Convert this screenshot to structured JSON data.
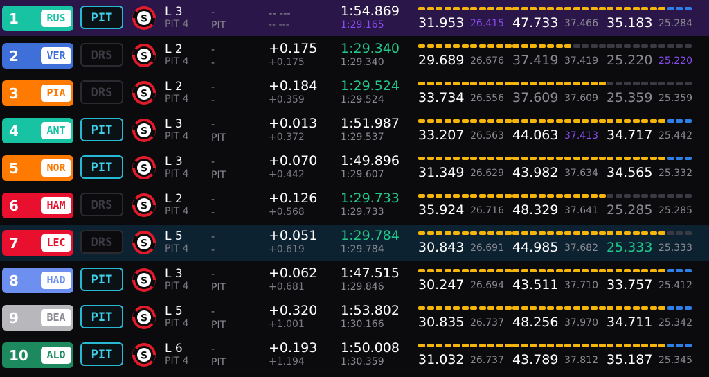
{
  "colors": {
    "yellow": "#f5b50a",
    "blue": "#2f7fe8",
    "dark": "#3a3a44",
    "green": "#22c88a",
    "purple": "#8a4cf0"
  },
  "tyre_icon_letter": "S",
  "rows": [
    {
      "pos": "1",
      "code": "RUS",
      "team_color": "#17c3a3",
      "code_color": "#17c3a3",
      "status": "PIT",
      "status_type": "pit",
      "lap": "L 3",
      "pit_count": "PIT 4",
      "dash1": "-",
      "dash2": "PIT",
      "gap": "-- ---",
      "gap_dim": true,
      "gap2": "-- ---",
      "last_lap": "1:54.869",
      "last_color": "white",
      "best_lap": "1:29.165",
      "best_color": "purple",
      "sectors": [
        {
          "val": "31.953",
          "val_color": "white",
          "best": "26.415",
          "best_color": "purple",
          "segs": "yyyyyyyyyyy"
        },
        {
          "val": "47.733",
          "val_color": "white",
          "best": "37.466",
          "best_color": "grey",
          "segs": "yyyyyyyyyyy"
        },
        {
          "val": "35.183",
          "val_color": "white",
          "best": "25.284",
          "best_color": "grey",
          "segs": "yyyyyyybbb"
        }
      ],
      "highlight": "purple"
    },
    {
      "pos": "2",
      "code": "VER",
      "team_color": "#3f6fd9",
      "code_color": "#3f6fd9",
      "status": "DRS",
      "status_type": "drs",
      "lap": "L 2",
      "pit_count": "PIT 4",
      "dash1": "-",
      "dash2": "-",
      "gap": "+0.175",
      "gap_dim": false,
      "gap2": "+0.175",
      "last_lap": "1:29.340",
      "last_color": "green",
      "best_lap": "1:29.340",
      "best_color": "grey",
      "sectors": [
        {
          "val": "29.689",
          "val_color": "white",
          "best": "26.676",
          "best_color": "grey",
          "segs": "yyyyyyyyyyy"
        },
        {
          "val": "37.419",
          "val_color": "grey",
          "best": "37.419",
          "best_color": "grey",
          "segs": "yyyyyyyddddd"
        },
        {
          "val": "25.220",
          "val_color": "grey",
          "best": "25.220",
          "best_color": "purple",
          "segs": "dddddddddd"
        }
      ],
      "highlight": ""
    },
    {
      "pos": "3",
      "code": "PIA",
      "team_color": "#ff7a00",
      "code_color": "#ff7a00",
      "status": "DRS",
      "status_type": "drs",
      "lap": "L 2",
      "pit_count": "PIT 4",
      "dash1": "-",
      "dash2": "-",
      "gap": "+0.184",
      "gap_dim": false,
      "gap2": "+0.359",
      "last_lap": "1:29.524",
      "last_color": "green",
      "best_lap": "1:29.524",
      "best_color": "grey",
      "sectors": [
        {
          "val": "33.734",
          "val_color": "white",
          "best": "26.556",
          "best_color": "grey",
          "segs": "yyyyyyyyyyy"
        },
        {
          "val": "37.609",
          "val_color": "grey",
          "best": "37.609",
          "best_color": "grey",
          "segs": "yyyyyyyyyyy"
        },
        {
          "val": "25.359",
          "val_color": "grey",
          "best": "25.359",
          "best_color": "grey",
          "segs": "dddddddddd"
        }
      ],
      "highlight": ""
    },
    {
      "pos": "4",
      "code": "ANT",
      "team_color": "#17c3a3",
      "code_color": "#17c3a3",
      "status": "PIT",
      "status_type": "pit",
      "lap": "L 3",
      "pit_count": "PIT 4",
      "dash1": "-",
      "dash2": "PIT",
      "gap": "+0.013",
      "gap_dim": false,
      "gap2": "+0.372",
      "last_lap": "1:51.987",
      "last_color": "white",
      "best_lap": "1:29.537",
      "best_color": "grey",
      "sectors": [
        {
          "val": "33.207",
          "val_color": "white",
          "best": "26.563",
          "best_color": "grey",
          "segs": "yyyyyyyyyyy"
        },
        {
          "val": "44.063",
          "val_color": "white",
          "best": "37.413",
          "best_color": "purple",
          "segs": "yyyyyyyyyyy"
        },
        {
          "val": "34.717",
          "val_color": "white",
          "best": "25.442",
          "best_color": "grey",
          "segs": "yyyyyyybbb"
        }
      ],
      "highlight": ""
    },
    {
      "pos": "5",
      "code": "NOR",
      "team_color": "#ff7a00",
      "code_color": "#ff7a00",
      "status": "PIT",
      "status_type": "pit",
      "lap": "L 3",
      "pit_count": "PIT 4",
      "dash1": "-",
      "dash2": "PIT",
      "gap": "+0.070",
      "gap_dim": false,
      "gap2": "+0.442",
      "last_lap": "1:49.896",
      "last_color": "white",
      "best_lap": "1:29.607",
      "best_color": "grey",
      "sectors": [
        {
          "val": "31.349",
          "val_color": "white",
          "best": "26.629",
          "best_color": "grey",
          "segs": "yyyyyyyyyyy"
        },
        {
          "val": "43.982",
          "val_color": "white",
          "best": "37.634",
          "best_color": "grey",
          "segs": "yyyyyyyyyyy"
        },
        {
          "val": "34.565",
          "val_color": "white",
          "best": "25.332",
          "best_color": "grey",
          "segs": "yyyyyyybbb"
        }
      ],
      "highlight": ""
    },
    {
      "pos": "6",
      "code": "HAM",
      "team_color": "#e8102e",
      "code_color": "#e8102e",
      "status": "DRS",
      "status_type": "drs",
      "lap": "L 2",
      "pit_count": "PIT 4",
      "dash1": "-",
      "dash2": "-",
      "gap": "+0.126",
      "gap_dim": false,
      "gap2": "+0.568",
      "last_lap": "1:29.733",
      "last_color": "green",
      "best_lap": "1:29.733",
      "best_color": "grey",
      "sectors": [
        {
          "val": "35.924",
          "val_color": "white",
          "best": "26.716",
          "best_color": "grey",
          "segs": "yyyyyyyyyyy"
        },
        {
          "val": "48.329",
          "val_color": "white",
          "best": "37.641",
          "best_color": "grey",
          "segs": "yyyyyyyyyyy"
        },
        {
          "val": "25.285",
          "val_color": "grey",
          "best": "25.285",
          "best_color": "grey",
          "segs": "dddddddddd"
        }
      ],
      "highlight": ""
    },
    {
      "pos": "7",
      "code": "LEC",
      "team_color": "#e8102e",
      "code_color": "#e8102e",
      "status": "DRS",
      "status_type": "drs",
      "lap": "L 5",
      "pit_count": "PIT 4",
      "dash1": "-",
      "dash2": "-",
      "gap": "+0.051",
      "gap_dim": false,
      "gap2": "+0.619",
      "last_lap": "1:29.784",
      "last_color": "green",
      "best_lap": "1:29.784",
      "best_color": "grey",
      "sectors": [
        {
          "val": "30.843",
          "val_color": "white",
          "best": "26.691",
          "best_color": "grey",
          "segs": "yyyyyyyyyyy"
        },
        {
          "val": "44.985",
          "val_color": "white",
          "best": "37.682",
          "best_color": "grey",
          "segs": "yyyyyyyyyyy"
        },
        {
          "val": "25.333",
          "val_color": "green",
          "best": "25.333",
          "best_color": "grey",
          "segs": "yyyyyyyddd"
        }
      ],
      "highlight": "teal"
    },
    {
      "pos": "8",
      "code": "HAD",
      "team_color": "#6d8ff0",
      "code_color": "#6d8ff0",
      "status": "PIT",
      "status_type": "pit",
      "lap": "L 3",
      "pit_count": "PIT 4",
      "dash1": "-",
      "dash2": "PIT",
      "gap": "+0.062",
      "gap_dim": false,
      "gap2": "+0.681",
      "last_lap": "1:47.515",
      "last_color": "white",
      "best_lap": "1:29.846",
      "best_color": "grey",
      "sectors": [
        {
          "val": "30.247",
          "val_color": "white",
          "best": "26.694",
          "best_color": "grey",
          "segs": "yyyyyyyyyyy"
        },
        {
          "val": "43.511",
          "val_color": "white",
          "best": "37.710",
          "best_color": "grey",
          "segs": "yyyyyyyyyyy"
        },
        {
          "val": "33.757",
          "val_color": "white",
          "best": "25.412",
          "best_color": "grey",
          "segs": "yyyyyyybbb"
        }
      ],
      "highlight": ""
    },
    {
      "pos": "9",
      "code": "BEA",
      "team_color": "#b8b8bc",
      "code_color": "#8a8a90",
      "status": "PIT",
      "status_type": "pit",
      "lap": "L 5",
      "pit_count": "PIT 4",
      "dash1": "-",
      "dash2": "PIT",
      "gap": "+0.320",
      "gap_dim": false,
      "gap2": "+1.001",
      "last_lap": "1:53.802",
      "last_color": "white",
      "best_lap": "1:30.166",
      "best_color": "grey",
      "sectors": [
        {
          "val": "30.835",
          "val_color": "white",
          "best": "26.737",
          "best_color": "grey",
          "segs": "yyyyyyyyyyy"
        },
        {
          "val": "48.256",
          "val_color": "white",
          "best": "37.970",
          "best_color": "grey",
          "segs": "yyyyyyyyyyy"
        },
        {
          "val": "34.711",
          "val_color": "white",
          "best": "25.342",
          "best_color": "grey",
          "segs": "yyyyyyybbb"
        }
      ],
      "highlight": ""
    },
    {
      "pos": "10",
      "code": "ALO",
      "team_color": "#1c8a5e",
      "code_color": "#1c8a5e",
      "status": "PIT",
      "status_type": "pit",
      "lap": "L 6",
      "pit_count": "PIT 4",
      "dash1": "-",
      "dash2": "PIT",
      "gap": "+0.193",
      "gap_dim": false,
      "gap2": "+1.194",
      "last_lap": "1:50.008",
      "last_color": "white",
      "best_lap": "1:30.359",
      "best_color": "grey",
      "sectors": [
        {
          "val": "31.032",
          "val_color": "white",
          "best": "26.737",
          "best_color": "grey",
          "segs": "yyyyyyyyyyy"
        },
        {
          "val": "43.789",
          "val_color": "white",
          "best": "37.812",
          "best_color": "grey",
          "segs": "yyyyyyyyyyy"
        },
        {
          "val": "35.187",
          "val_color": "white",
          "best": "25.345",
          "best_color": "grey",
          "segs": "yyyyyyybbb"
        }
      ],
      "highlight": ""
    }
  ]
}
